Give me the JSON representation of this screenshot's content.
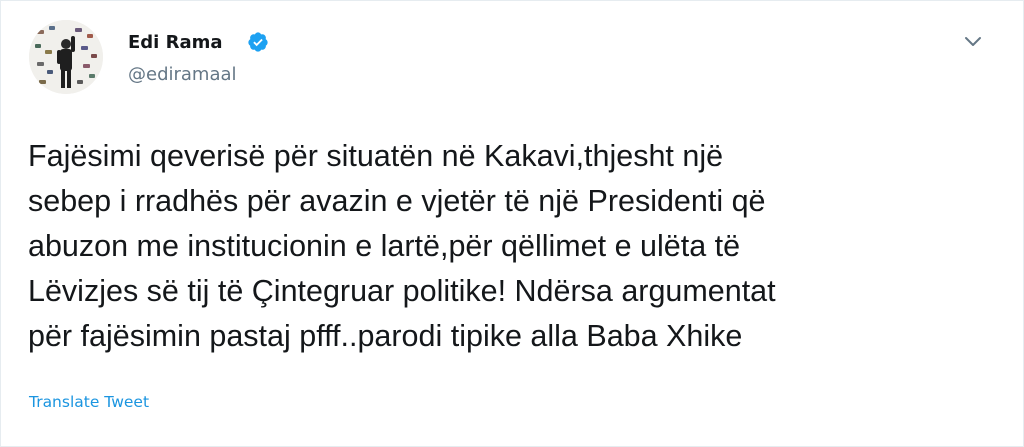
{
  "author": {
    "name": "Edi Rama",
    "handle": "@ediramaal",
    "verified_icon": "verified-badge-icon",
    "avatar_icon": "profile-photo"
  },
  "menu": {
    "icon": "chevron-down-icon"
  },
  "tweet": {
    "lines": [
      "Fajësimi qeverisë për situatën në Kakavi,thjesht një",
      "sebep i rradhës për avazin e vjetër të një Presidenti që",
      "abuzon me institucionin e lartë,për qëllimet e ulëta të",
      "Lëvizjes së tij të Çintegruar politike! Ndërsa argumentat",
      "për fajësimin pastaj pfff..parodi tipike alla Baba Xhike"
    ]
  },
  "actions": {
    "translate_label": "Translate Tweet"
  },
  "colors": {
    "text": "#14171a",
    "secondary": "#657786",
    "link": "#1b95e0",
    "verified": "#1da1f2",
    "border": "#e6ecf0"
  }
}
